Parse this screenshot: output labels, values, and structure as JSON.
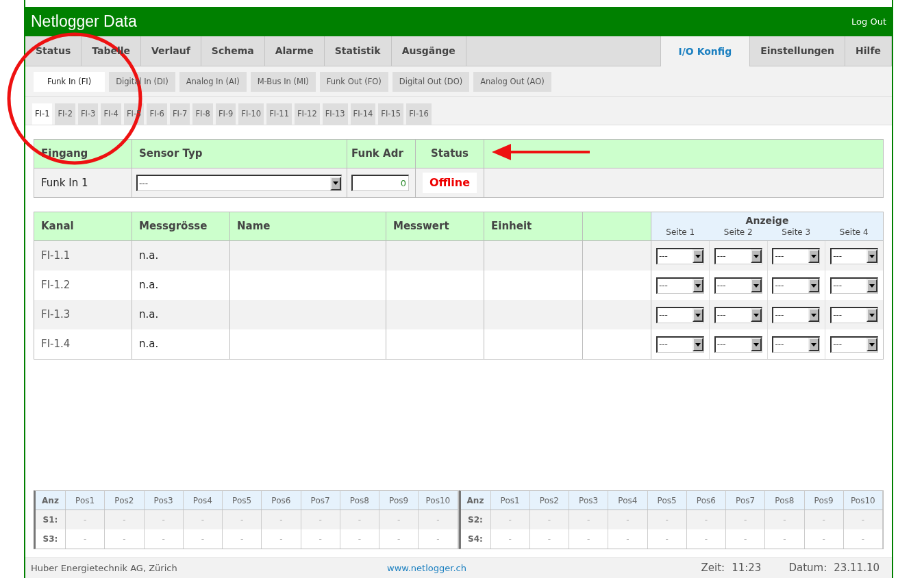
{
  "header": {
    "title": "Netlogger Data",
    "logout": "Log Out"
  },
  "main_tabs": [
    {
      "label": "Status",
      "selected": false
    },
    {
      "label": "Tabelle",
      "selected": false
    },
    {
      "label": "Verlauf",
      "selected": false
    },
    {
      "label": "Schema",
      "selected": false
    },
    {
      "label": "Alarme",
      "selected": false
    },
    {
      "label": "Statistik",
      "selected": false
    },
    {
      "label": "Ausgänge",
      "selected": false
    },
    {
      "kind": "spacer"
    },
    {
      "label": "I/O Konfig",
      "selected": true
    },
    {
      "label": "Einstellungen",
      "selected": false
    },
    {
      "label": "Hilfe",
      "selected": false
    }
  ],
  "io_tabs": [
    {
      "label": "Funk In (FI)",
      "selected": true
    },
    {
      "label": "Digital In (DI)",
      "selected": false
    },
    {
      "label": "Analog In (AI)",
      "selected": false
    },
    {
      "label": "M-Bus In (MI)",
      "selected": false
    },
    {
      "label": "Funk Out (FO)",
      "selected": false
    },
    {
      "label": "Digital Out (DO)",
      "selected": false
    },
    {
      "label": "Analog Out (AO)",
      "selected": false
    }
  ],
  "channel_tabs": [
    {
      "label": "FI-1",
      "selected": true
    },
    {
      "label": "FI-2",
      "selected": false
    },
    {
      "label": "FI-3",
      "selected": false
    },
    {
      "label": "FI-4",
      "selected": false
    },
    {
      "label": "FI-5",
      "selected": false
    },
    {
      "label": "FI-6",
      "selected": false
    },
    {
      "label": "FI-7",
      "selected": false
    },
    {
      "label": "FI-8",
      "selected": false
    },
    {
      "label": "FI-9",
      "selected": false
    },
    {
      "label": "FI-10",
      "selected": false
    },
    {
      "label": "FI-11",
      "selected": false
    },
    {
      "label": "FI-12",
      "selected": false
    },
    {
      "label": "FI-13",
      "selected": false
    },
    {
      "label": "FI-14",
      "selected": false
    },
    {
      "label": "FI-15",
      "selected": false
    },
    {
      "label": "FI-16",
      "selected": false
    }
  ],
  "input_table": {
    "columns": [
      "Eingang",
      "Sensor Typ",
      "Funk Adr",
      "Status"
    ],
    "row": {
      "eingang": "Funk In 1",
      "sensor_typ": "---",
      "funk_adr": "0",
      "status": "Offline"
    }
  },
  "channel_table": {
    "columns": [
      "Kanal",
      "Messgrösse",
      "Name",
      "Messwert",
      "Einheit"
    ],
    "display_header": "Anzeige",
    "pages": [
      "Seite 1",
      "Seite 2",
      "Seite 3",
      "Seite 4"
    ],
    "rows": [
      {
        "kanal": "FI-1.1",
        "messgroesse": "n.a.",
        "selects": [
          "---",
          "---",
          "---",
          "---"
        ]
      },
      {
        "kanal": "FI-1.2",
        "messgroesse": "n.a.",
        "selects": [
          "---",
          "---",
          "---",
          "---"
        ]
      },
      {
        "kanal": "FI-1.3",
        "messgroesse": "n.a.",
        "selects": [
          "---",
          "---",
          "---",
          "---"
        ]
      },
      {
        "kanal": "FI-1.4",
        "messgroesse": "n.a.",
        "selects": [
          "---",
          "---",
          "---",
          "---"
        ]
      }
    ]
  },
  "position_tables": [
    {
      "columns": [
        "Anz",
        "Pos1",
        "Pos2",
        "Pos3",
        "Pos4",
        "Pos5",
        "Pos6",
        "Pos7",
        "Pos8",
        "Pos9",
        "Pos10"
      ],
      "rows": [
        [
          "S1:",
          "-",
          "-",
          "-",
          "-",
          "-",
          "-",
          "-",
          "-",
          "-",
          "-"
        ],
        [
          "S3:",
          "-",
          "-",
          "-",
          "-",
          "-",
          "-",
          "-",
          "-",
          "-",
          "-"
        ]
      ]
    },
    {
      "columns": [
        "Anz",
        "Pos1",
        "Pos2",
        "Pos3",
        "Pos4",
        "Pos5",
        "Pos6",
        "Pos7",
        "Pos8",
        "Pos9",
        "Pos10"
      ],
      "rows": [
        [
          "S2:",
          "-",
          "-",
          "-",
          "-",
          "-",
          "-",
          "-",
          "-",
          "-",
          "-"
        ],
        [
          "S4:",
          "-",
          "-",
          "-",
          "-",
          "-",
          "-",
          "-",
          "-",
          "-",
          "-"
        ]
      ]
    }
  ],
  "footer": {
    "company": "Huber Energietechnik AG, Zürich",
    "link": "www.netlogger.ch",
    "time_label": "Zeit:",
    "time": "11:23",
    "date_label": "Datum:",
    "date": "23.11.10"
  }
}
